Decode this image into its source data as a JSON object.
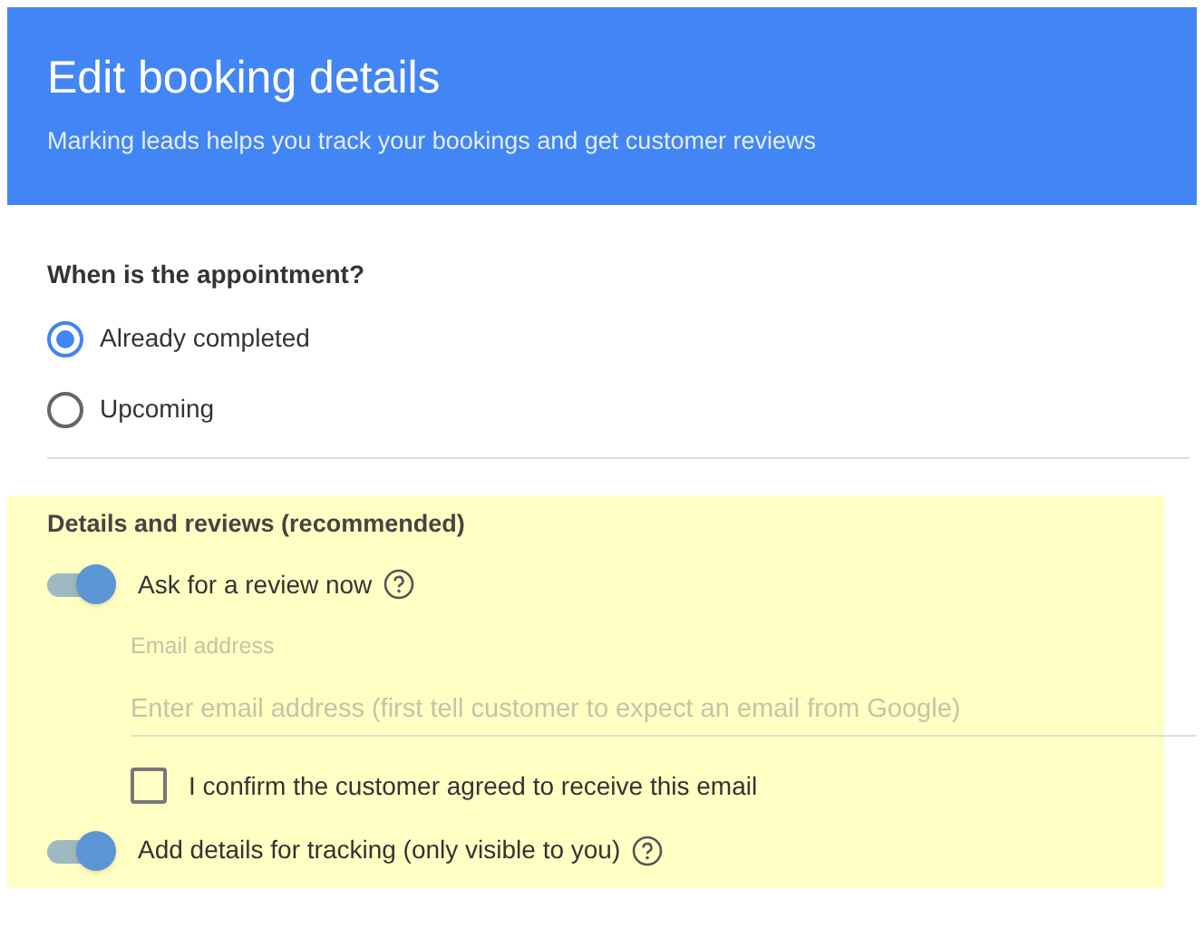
{
  "header": {
    "title": "Edit booking details",
    "subtitle": "Marking leads helps you track your bookings and get customer reviews"
  },
  "appointment": {
    "question": "When is the appointment?",
    "options": [
      {
        "label": "Already completed",
        "selected": true
      },
      {
        "label": "Upcoming",
        "selected": false
      }
    ]
  },
  "details": {
    "heading": "Details and reviews (recommended)",
    "review_toggle": {
      "label": "Ask for a review now",
      "on": true
    },
    "email": {
      "label": "Email address",
      "placeholder": "Enter email address (first tell customer to expect an email from Google)"
    },
    "confirm": {
      "label": "I confirm the customer agreed to receive this email",
      "checked": false
    },
    "tracking_toggle": {
      "label": "Add details for tracking (only visible to you)",
      "on": true
    }
  }
}
